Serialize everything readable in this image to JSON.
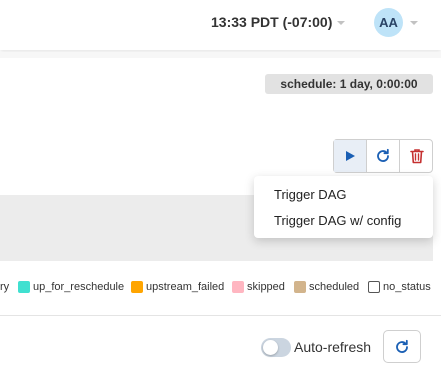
{
  "header": {
    "timezone_label": "13:33 PDT (-07:00)",
    "avatar_initials": "AA"
  },
  "schedule_badge": "schedule: 1 day, 0:00:00",
  "actions": {
    "trigger_icon": "play-icon",
    "refresh_icon": "refresh-icon",
    "delete_icon": "trash-icon"
  },
  "trigger_menu": {
    "items": [
      "Trigger DAG",
      "Trigger DAG w/ config"
    ]
  },
  "legend": [
    {
      "label": "ry",
      "color": ""
    },
    {
      "label": "up_for_reschedule",
      "color": "#40e0d0"
    },
    {
      "label": "upstream_failed",
      "color": "#ffa500"
    },
    {
      "label": "skipped",
      "color": "#ffb6c1"
    },
    {
      "label": "scheduled",
      "color": "#d2b48c"
    },
    {
      "label": "no_status",
      "color": "#ffffff"
    }
  ],
  "footer": {
    "auto_refresh_label": "Auto-refresh",
    "auto_refresh_on": false
  },
  "colors": {
    "accent_blue": "#1a5fb4",
    "delete_red": "#c53030",
    "avatar_bg": "#bee3f8"
  }
}
